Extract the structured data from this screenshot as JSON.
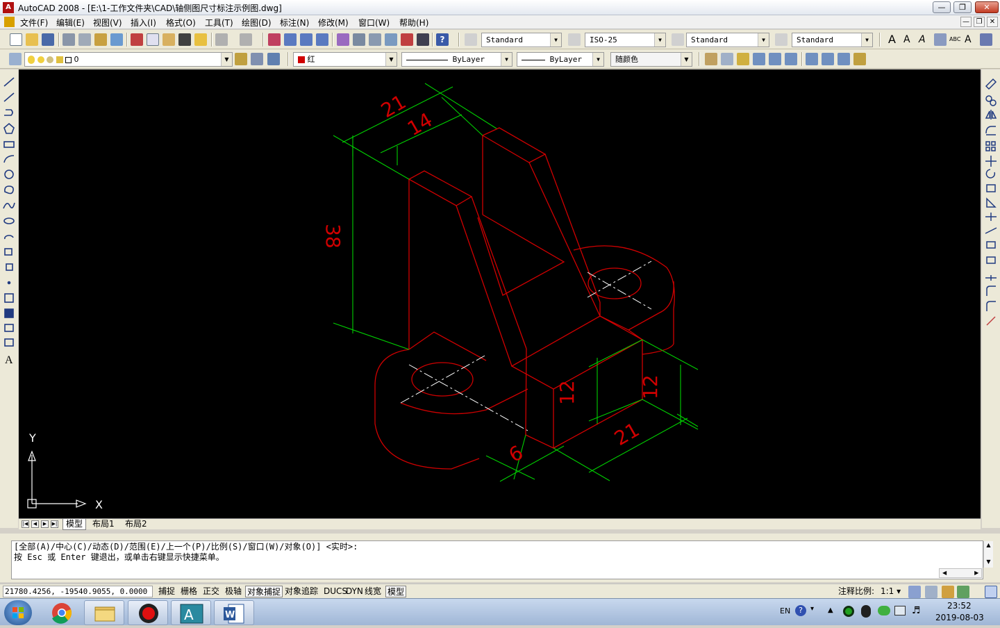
{
  "window": {
    "title": "AutoCAD 2008 - [E:\\1-工作文件夹\\CAD\\轴侧图尺寸标注示例图.dwg]",
    "app_icon_letter": "A"
  },
  "menu": [
    "文件(F)",
    "编辑(E)",
    "视图(V)",
    "插入(I)",
    "格式(O)",
    "工具(T)",
    "绘图(D)",
    "标注(N)",
    "修改(M)",
    "窗口(W)",
    "帮助(H)"
  ],
  "toolbar": {
    "text_style": "Standard",
    "dim_style": "ISO-25",
    "table_style": "Standard",
    "mleader_style": "Standard",
    "layer": "0",
    "color": "红",
    "color_swatch": "#d00000",
    "linetype": "ByLayer",
    "lineweight": "ByLayer",
    "plot_style": "随颜色"
  },
  "drawing": {
    "line_color": "#d00000",
    "dim_color": "#00d000",
    "center_color": "#ffffff",
    "dimensions": [
      "21",
      "14",
      "38",
      "12",
      "12",
      "21",
      "6"
    ],
    "ucs_x": "X",
    "ucs_y": "Y"
  },
  "layout_tabs": [
    "模型",
    "布局1",
    "布局2"
  ],
  "command": {
    "line1": "[全部(A)/中心(C)/动态(D)/范围(E)/上一个(P)/比例(S)/窗口(W)/对象(O)] <实时>:",
    "line2": "按 Esc 或 Enter 键退出，或单击右键显示快捷菜单。"
  },
  "status": {
    "coords": "21780.4256, -19540.9055, 0.0000",
    "buttons": [
      "捕捉",
      "栅格",
      "正交",
      "极轴",
      "对象捕捉",
      "对象追踪",
      "DUCS",
      "DYN",
      "线宽",
      "模型"
    ],
    "annotation_scale_label": "注释比例:",
    "annotation_scale_value": "1:1"
  },
  "taskbar": {
    "lang": "EN",
    "time": "23:52",
    "date": "2019-08-03"
  }
}
